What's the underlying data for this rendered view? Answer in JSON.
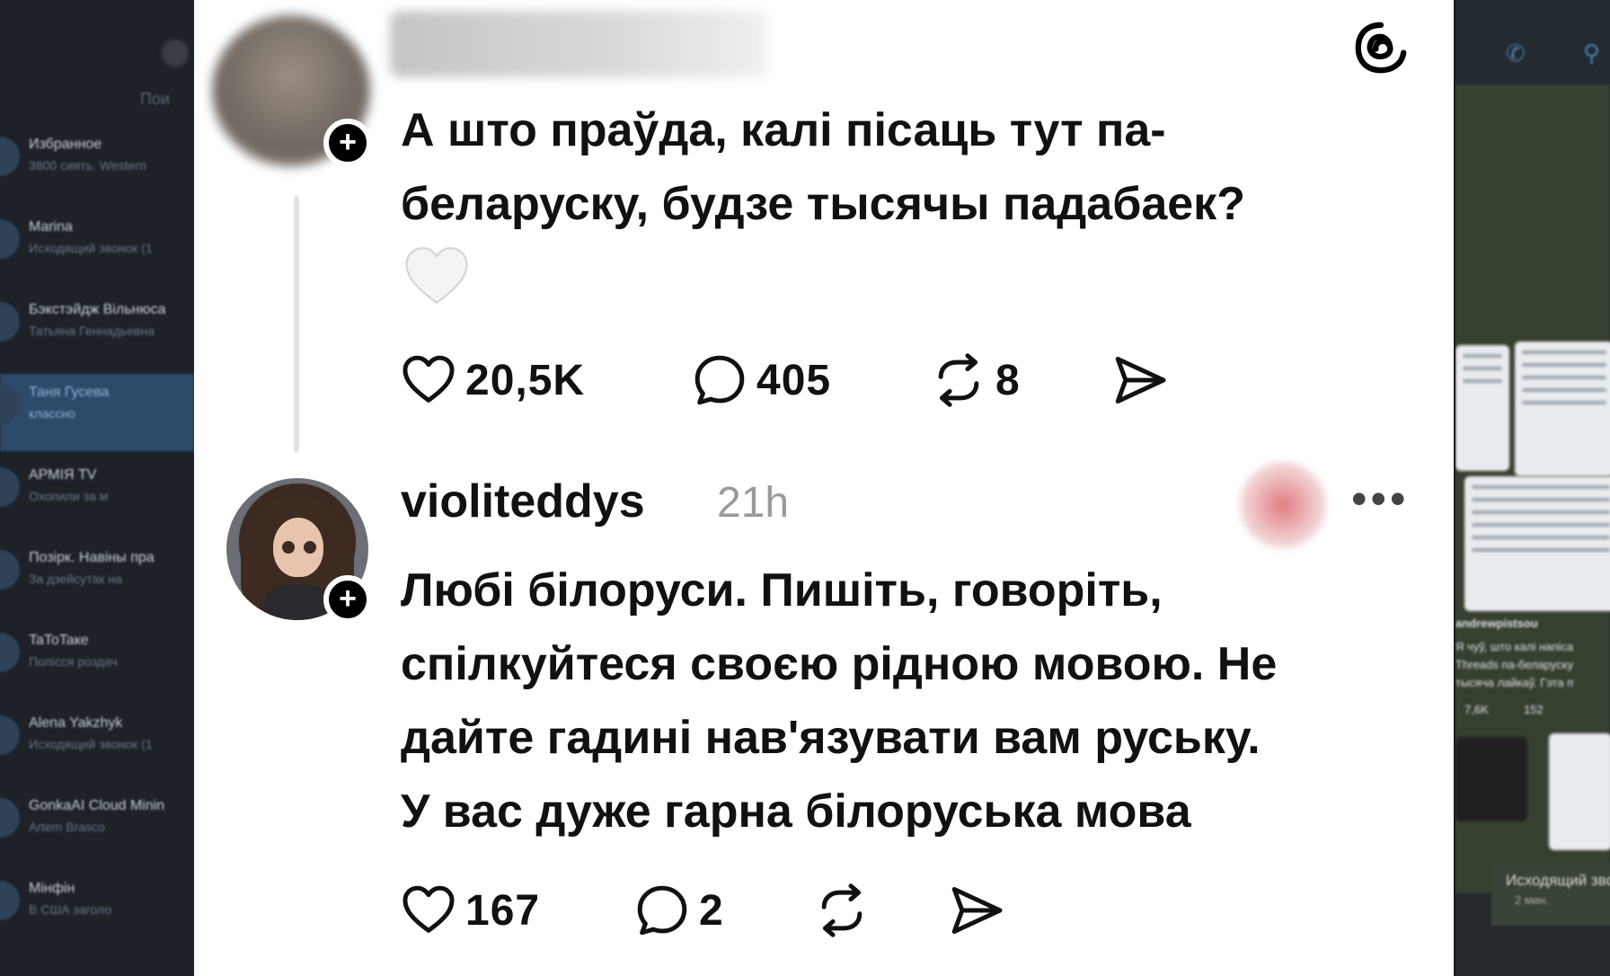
{
  "background_left": {
    "search_hint": "Пои",
    "chats": [
      {
        "name": "Избранное",
        "sub": "3800 сиять. Western"
      },
      {
        "name": "Marina",
        "sub": "Исходящий звонок (1"
      },
      {
        "name": "Бэкстэйдж Вільнюса",
        "sub": "Татьяна Геннадьевна"
      },
      {
        "name": "Таня Гусева",
        "sub": "классно"
      },
      {
        "name": "АРМІЯ TV",
        "sub": "Охопили за м"
      },
      {
        "name": "Позірк. Навіны пра",
        "sub": "За дзейсутак на"
      },
      {
        "name": "TaToTaкe",
        "sub": "Полісся роздач"
      },
      {
        "name": "Alena Yakzhyk",
        "sub": "Исходящий звонок (1"
      },
      {
        "name": "GonkaAI Cloud Minin",
        "sub": "Artem Brasco"
      },
      {
        "name": "Мінфін",
        "sub": "В США заголо"
      }
    ]
  },
  "background_right": {
    "snippet_user": "andrewpistsou",
    "snippet_lines": [
      "Я чуў, што калі напіса",
      "Threads па-беларуску",
      "тысяча лайкаў. Гэта п"
    ],
    "snippet_stats": [
      "7,6K",
      "152"
    ],
    "call_title": "Исходящий зво",
    "call_sub": "2 мин."
  },
  "post": {
    "text_line1": "А што праўда, калі пісаць тут па-",
    "text_line2": "беларуску, будзе тысячы падабаек?",
    "likes": "20,5K",
    "replies": "405",
    "reposts": "8"
  },
  "reply": {
    "username": "violiteddys",
    "time": "21h",
    "more": "•••",
    "text_lines": [
      "Любі білоруси. Пишіть, говоріть,",
      "спілкуйтеся своєю рідною мовою. Не",
      "дайте гадині нав'язувати вам руську.",
      "У вас дуже гарна білоруська мова"
    ],
    "likes": "167",
    "replies": "2"
  },
  "icons": {
    "follow": "plus-icon",
    "heart_emoji": "white-heart-emoji",
    "like": "heart-icon",
    "comment": "comment-icon",
    "repost": "repost-icon",
    "share": "send-icon",
    "logo": "threads-logo"
  }
}
